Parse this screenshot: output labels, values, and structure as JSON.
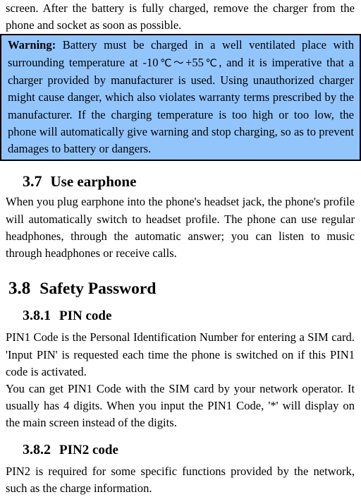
{
  "page": {
    "background_color": "#ffffff",
    "text_color": "#000000"
  },
  "intro_paragraph": {
    "text": "screen. After the battery is fully charged, remove the charger from the phone and socket as soon as possible."
  },
  "warning_callout": {
    "background_color": "#93c5fd",
    "border_color": "#000000",
    "label": "Warning:",
    "text": " Battery must be charged in a well ventilated place with surrounding temperature at -10",
    "temp_unit_low": "℃",
    "range_separator": "～",
    "temp_high": "+55",
    "temp_unit_high": "℃",
    "text_continued": ", and it is imperative that a charger provided by manufacturer is used. Using unauthorized charger might cause danger, which also violates warranty terms prescribed by the manufacturer. If the charging temperature is too high or too low, the phone will automatically give warning and stop charging, so as to prevent damages to battery or dangers."
  },
  "section_37": {
    "number": "3.7",
    "title": "Use earphone",
    "body": "When you plug earphone into the phone's headset jack, the phone's profile will automatically switch to headset profile. The phone can use regular headphones, through the automatic answer; you can listen to music through headphones or receive calls."
  },
  "section_38": {
    "number": "3.8",
    "title": "Safety Password"
  },
  "section_381": {
    "number": "3.8.1",
    "title": "PIN code",
    "paragraph_1": "PIN1 Code is the Personal Identification Number for entering a SIM card. 'Input PIN' is requested each time the phone is switched on if this PIN1 code is activated.",
    "paragraph_2": "You can get PIN1 Code with the SIM card by your network operator. It usually has 4 digits. When you input the PIN1 Code, '*' will display on the main screen instead of the digits."
  },
  "section_382": {
    "number": "3.8.2",
    "title": "PIN2 code",
    "paragraph_1": "PIN2 is required for some specific functions provided by the network, such as the charge information."
  }
}
